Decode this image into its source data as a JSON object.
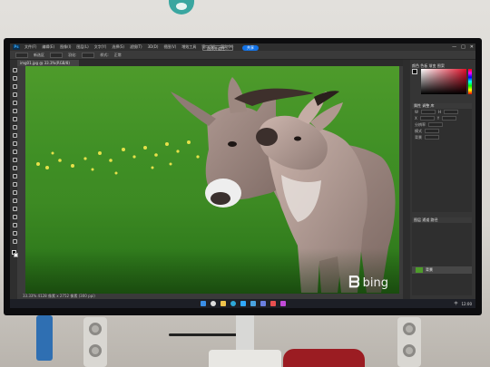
{
  "photoshop": {
    "logo": "Ps",
    "menu": [
      "文件(F)",
      "编辑(E)",
      "图像(I)",
      "图层(L)",
      "文字(Y)",
      "选择(S)",
      "滤镜(T)",
      "3D(D)",
      "视图(V)",
      "增效工具",
      "窗口(W)",
      "帮助(H)"
    ],
    "window_controls": [
      "—",
      "□",
      "✕"
    ],
    "options": {
      "mode_label": "新选区",
      "feather_label": "羽化:",
      "style_label": "样式:",
      "style_value": "正常",
      "select_mask_button": "选择并遮住...",
      "share_pill": "共享"
    },
    "document_tab": "img01.jpg @ 33.3%(RGB/8)",
    "status": "33.33%   4128 像素 x 2752 像素 (300 ppi)",
    "panels": {
      "color_tabs": "颜色  色板  渐变  图案",
      "properties_header": "属性  调整  库",
      "properties_rows": [
        {
          "key": "W",
          "key2": "H"
        },
        {
          "key": "X",
          "key2": "Y"
        },
        {
          "key": "分辨率"
        },
        {
          "key": "模式"
        },
        {
          "key": "背景"
        }
      ],
      "layers_header": "图层  通道  路径",
      "layer_name": "背景"
    }
  },
  "canvas": {
    "watermark_logo": "ᗷ",
    "watermark_text": "bing"
  },
  "taskbar": {
    "icons": [
      {
        "name": "windows-start-icon",
        "color": "#3a8ee6"
      },
      {
        "name": "search-icon",
        "color": "#dddddd"
      },
      {
        "name": "file-explorer-icon",
        "color": "#f0c24b"
      },
      {
        "name": "edge-icon",
        "color": "#2ea7d8"
      },
      {
        "name": "photoshop-icon",
        "color": "#31a8ff"
      },
      {
        "name": "mail-icon",
        "color": "#4aa3e0"
      },
      {
        "name": "store-icon",
        "color": "#6b7fe0"
      },
      {
        "name": "media-icon",
        "color": "#e85050"
      },
      {
        "name": "app-icon",
        "color": "#c24bd8"
      }
    ],
    "tray_lang": "中",
    "tray_time": "12:00"
  }
}
